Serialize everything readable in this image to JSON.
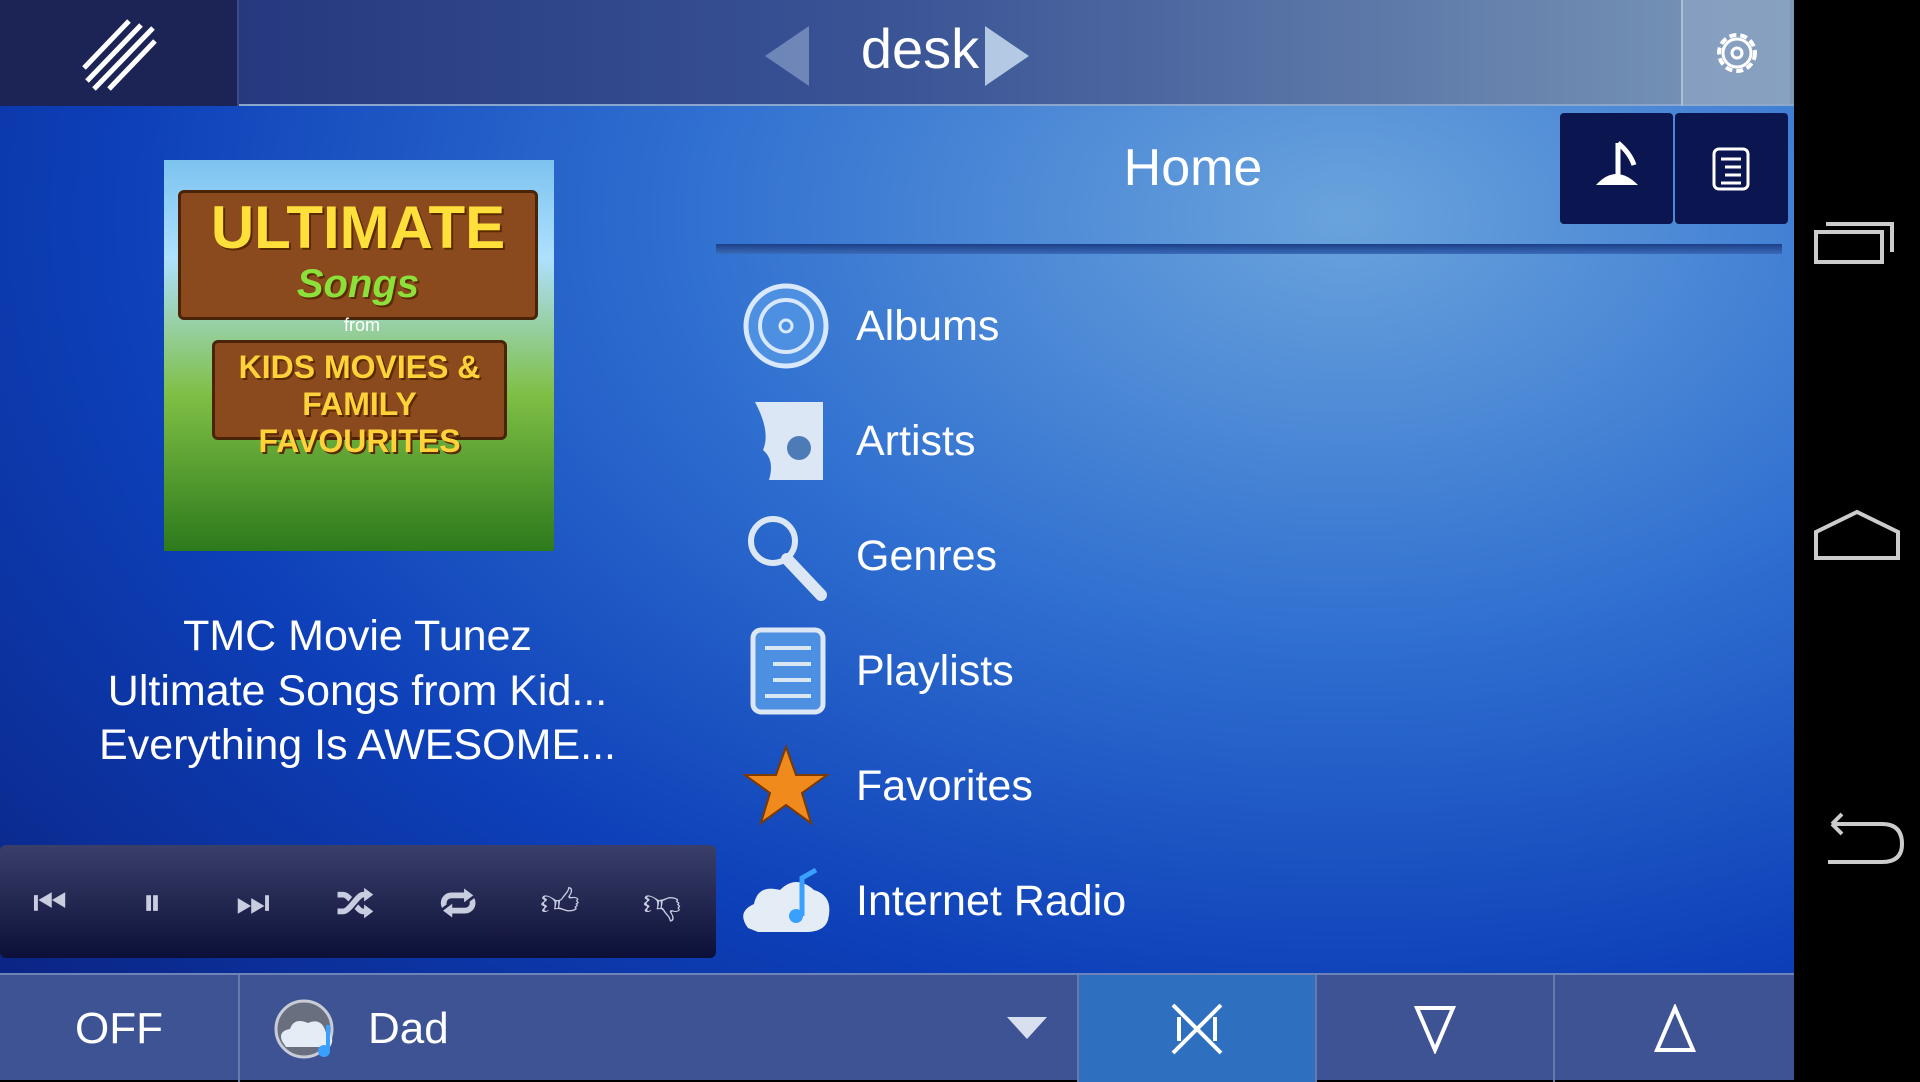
{
  "header": {
    "zone": "desk",
    "prev_icon": "triangle-left-icon",
    "next_icon": "triangle-right-icon",
    "settings_icon": "gear-icon",
    "logo_icon": "striped-logo-icon"
  },
  "now_playing": {
    "album_art": {
      "line1": "ULTIMATE",
      "line2": "Songs",
      "line3": "from",
      "line4": "KIDS MOVIES &",
      "line5": "FAMILY FAVOURITES"
    },
    "artist": "TMC Movie Tunez",
    "album": "Ultimate Songs from Kid...",
    "track": "Everything Is AWESOME..."
  },
  "main": {
    "title": "Home",
    "header_buttons": [
      {
        "icon": "music-note-icon"
      },
      {
        "icon": "list-icon"
      }
    ],
    "items": [
      {
        "label": "Albums",
        "icon": "disc-icon"
      },
      {
        "label": "Artists",
        "icon": "artist-icon"
      },
      {
        "label": "Genres",
        "icon": "microphone-icon"
      },
      {
        "label": "Playlists",
        "icon": "playlist-icon"
      },
      {
        "label": "Favorites",
        "icon": "star-icon"
      },
      {
        "label": "Internet Radio",
        "icon": "cloud-music-icon"
      }
    ]
  },
  "controls": [
    "previous",
    "pause",
    "next",
    "shuffle",
    "repeat",
    "thumbs-up",
    "thumbs-down"
  ],
  "bottom": {
    "power_label": "OFF",
    "source_label": "Dad",
    "source_icon": "cloud-music-icon",
    "accent": "#2e6fc0"
  },
  "android_nav": [
    "recent-apps",
    "home",
    "back"
  ]
}
